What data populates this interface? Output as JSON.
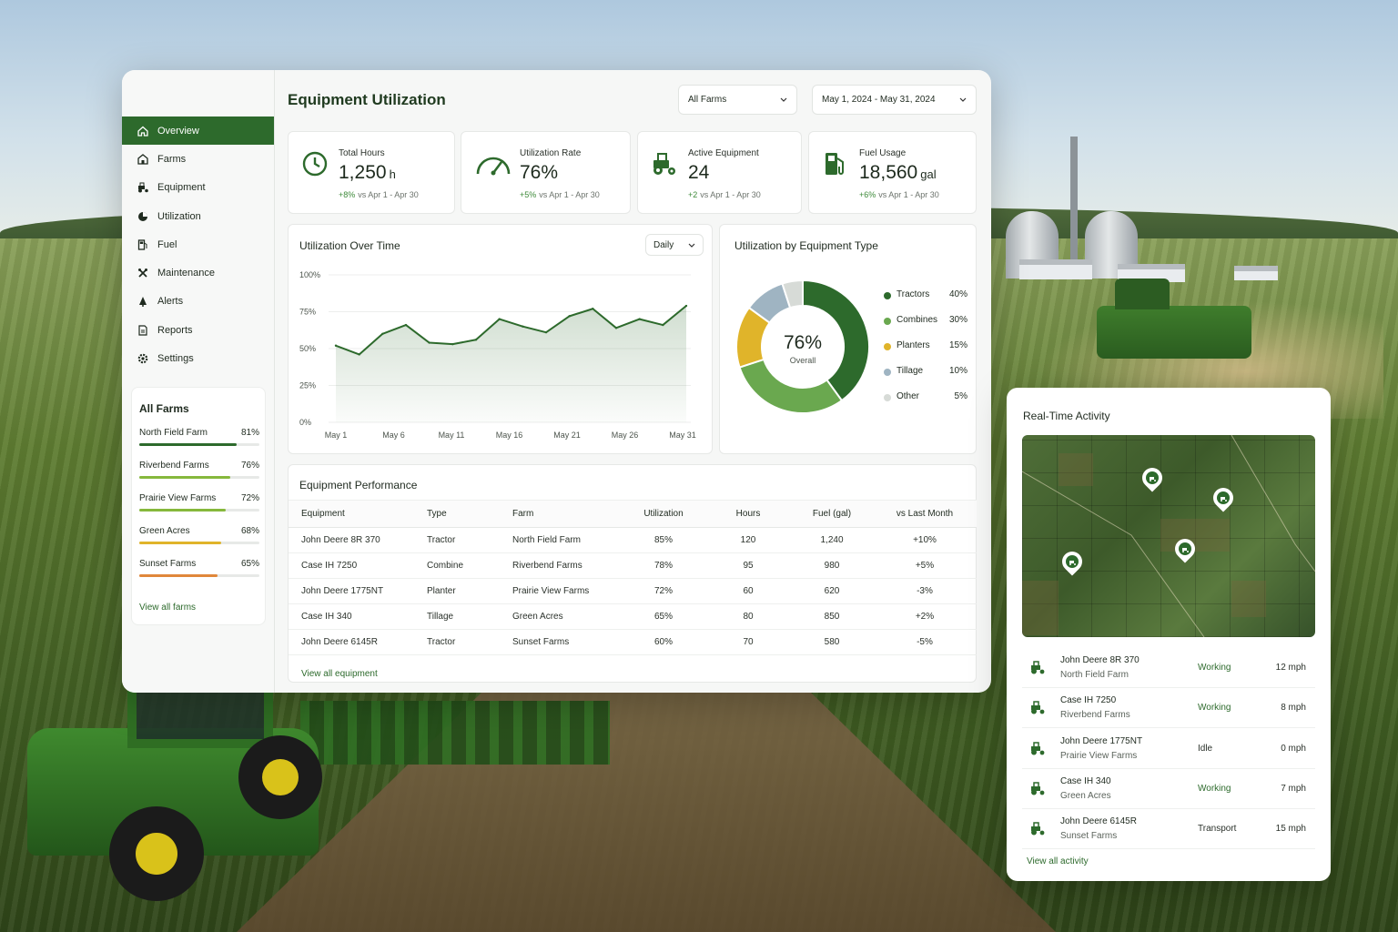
{
  "colors": {
    "brand": "#2d6a2c",
    "positive": "#3e8a3a",
    "negative": "#c9483a",
    "amber": "#e0b42a"
  },
  "page": {
    "title": "Equipment Utilization"
  },
  "filters": {
    "farm": "All Farms",
    "date_range": "May 1, 2024 - May 31, 2024"
  },
  "sidebar": {
    "items": [
      {
        "label": "Overview",
        "icon": "home-icon"
      },
      {
        "label": "Farms",
        "icon": "barn-icon"
      },
      {
        "label": "Equipment",
        "icon": "tractor-icon"
      },
      {
        "label": "Utilization",
        "icon": "pie-icon"
      },
      {
        "label": "Fuel",
        "icon": "fuel-icon"
      },
      {
        "label": "Maintenance",
        "icon": "wrench-icon"
      },
      {
        "label": "Alerts",
        "icon": "bell-icon"
      },
      {
        "label": "Reports",
        "icon": "document-icon"
      },
      {
        "label": "Settings",
        "icon": "gear-icon"
      }
    ],
    "farms": {
      "title": "All Farms",
      "items": [
        {
          "name": "North Field Farm",
          "pct": "81%",
          "value": 0.81,
          "color": "#2d6a2c"
        },
        {
          "name": "Riverbend Farms",
          "pct": "76%",
          "value": 0.76,
          "color": "#86b83c"
        },
        {
          "name": "Prairie View Farms",
          "pct": "72%",
          "value": 0.72,
          "color": "#86b83c"
        },
        {
          "name": "Green Acres",
          "pct": "68%",
          "value": 0.68,
          "color": "#e0b42a"
        },
        {
          "name": "Sunset Farms",
          "pct": "65%",
          "value": 0.65,
          "color": "#e0873a"
        }
      ],
      "link": "View all farms"
    }
  },
  "kpis": [
    {
      "label": "Total Hours",
      "value": "1,250",
      "unit": "h",
      "delta": "+8%",
      "compare": "vs Apr 1 - Apr 30",
      "icon": "clock-icon"
    },
    {
      "label": "Utilization Rate",
      "value": "76%",
      "unit": "",
      "delta": "+5%",
      "compare": "vs Apr 1 - Apr 30",
      "icon": "gauge-icon"
    },
    {
      "label": "Active Equipment",
      "value": "24",
      "unit": "",
      "delta": "+2",
      "compare": "vs Apr 1 - Apr 30",
      "icon": "tractor-icon"
    },
    {
      "label": "Fuel Usage",
      "value": "18,560",
      "unit": "gal",
      "delta": "+6%",
      "compare": "vs Apr 1 - Apr 30",
      "icon": "fuel-pump-icon"
    }
  ],
  "utilization_chart": {
    "title": "Utilization Over Time",
    "granularity": "Daily"
  },
  "type_chart": {
    "title": "Utilization by Equipment Type",
    "center_value": "76%",
    "center_label": "Overall"
  },
  "chart_data": [
    {
      "type": "area",
      "title": "Utilization Over Time",
      "x": [
        "May 1",
        "May 3",
        "May 5",
        "May 7",
        "May 9",
        "May 11",
        "May 13",
        "May 15",
        "May 17",
        "May 19",
        "May 21",
        "May 23",
        "May 25",
        "May 27",
        "May 29",
        "May 31"
      ],
      "y": [
        52,
        46,
        60,
        66,
        54,
        53,
        56,
        70,
        65,
        61,
        72,
        77,
        64,
        70,
        66,
        79
      ],
      "xticks": [
        "May 1",
        "May 6",
        "May 11",
        "May 16",
        "May 21",
        "May 26",
        "May 31"
      ],
      "yticks": [
        "0%",
        "25%",
        "50%",
        "75%",
        "100%"
      ],
      "ylim": [
        0,
        100
      ],
      "grid": true
    },
    {
      "type": "pie",
      "title": "Utilization by Equipment Type",
      "labels": [
        "Tractors",
        "Combines",
        "Planters",
        "Tillage",
        "Other"
      ],
      "values": [
        40,
        30,
        15,
        10,
        5
      ],
      "display": [
        "40%",
        "30%",
        "15%",
        "10%",
        "5%"
      ],
      "colors": [
        "#2d6a2c",
        "#6aa84f",
        "#e0b42a",
        "#9fb4c2",
        "#d7dbd7"
      ],
      "legend": "right"
    }
  ],
  "performance": {
    "title": "Equipment Performance",
    "columns": [
      "Equipment",
      "Type",
      "Farm",
      "Utilization",
      "Hours",
      "Fuel (gal)",
      "vs Last Month"
    ],
    "rows": [
      [
        "John Deere 8R 370",
        "Tractor",
        "North Field Farm",
        "85%",
        "120",
        "1,240",
        "+10%"
      ],
      [
        "Case IH 7250",
        "Combine",
        "Riverbend Farms",
        "78%",
        "95",
        "980",
        "+5%"
      ],
      [
        "John Deere 1775NT",
        "Planter",
        "Prairie View Farms",
        "72%",
        "60",
        "620",
        "-3%"
      ],
      [
        "Case IH 340",
        "Tillage",
        "Green Acres",
        "65%",
        "80",
        "850",
        "+2%"
      ],
      [
        "John Deere 6145R",
        "Tractor",
        "Sunset Farms",
        "60%",
        "70",
        "580",
        "-5%"
      ]
    ],
    "link": "View all equipment"
  },
  "activity": {
    "title": "Real-Time Activity",
    "items": [
      {
        "name": "John Deere 8R 370",
        "farm": "North Field Farm",
        "status": "Working",
        "speed": "12 mph"
      },
      {
        "name": "Case IH 7250",
        "farm": "Riverbend Farms",
        "status": "Working",
        "speed": "8 mph"
      },
      {
        "name": "John Deere 1775NT",
        "farm": "Prairie View Farms",
        "status": "Idle",
        "speed": "0 mph"
      },
      {
        "name": "Case IH 340",
        "farm": "Green Acres",
        "status": "Working",
        "speed": "7 mph"
      },
      {
        "name": "John Deere 6145R",
        "farm": "Sunset Farms",
        "status": "Transport",
        "speed": "15 mph"
      }
    ],
    "link": "View all activity"
  }
}
